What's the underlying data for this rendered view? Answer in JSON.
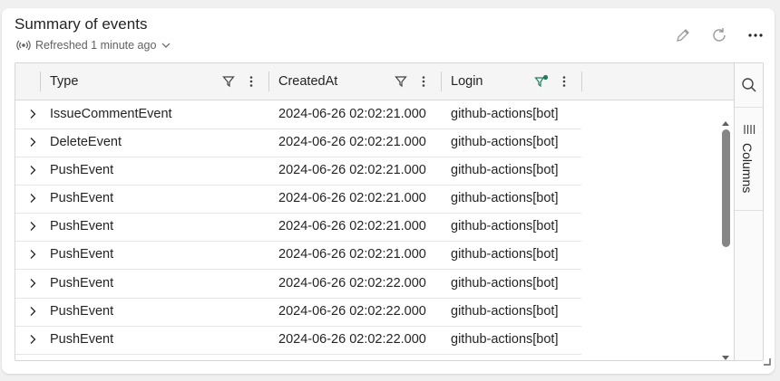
{
  "widget": {
    "title": "Summary of events",
    "refresh_status": "Refreshed 1 minute ago"
  },
  "toolbar": {
    "icons": [
      "edit-icon",
      "refresh-icon",
      "more-icon"
    ]
  },
  "grid": {
    "columns": [
      {
        "label": "Type",
        "filter_active": false
      },
      {
        "label": "CreatedAt",
        "filter_active": false
      },
      {
        "label": "Login",
        "filter_active": true
      }
    ],
    "rows": [
      {
        "type": "IssueCommentEvent",
        "created_at": "2024-06-26 02:02:21.000",
        "login": "github-actions[bot]"
      },
      {
        "type": "DeleteEvent",
        "created_at": "2024-06-26 02:02:21.000",
        "login": "github-actions[bot]"
      },
      {
        "type": "PushEvent",
        "created_at": "2024-06-26 02:02:21.000",
        "login": "github-actions[bot]"
      },
      {
        "type": "PushEvent",
        "created_at": "2024-06-26 02:02:21.000",
        "login": "github-actions[bot]"
      },
      {
        "type": "PushEvent",
        "created_at": "2024-06-26 02:02:21.000",
        "login": "github-actions[bot]"
      },
      {
        "type": "PushEvent",
        "created_at": "2024-06-26 02:02:21.000",
        "login": "github-actions[bot]"
      },
      {
        "type": "PushEvent",
        "created_at": "2024-06-26 02:02:22.000",
        "login": "github-actions[bot]"
      },
      {
        "type": "PushEvent",
        "created_at": "2024-06-26 02:02:22.000",
        "login": "github-actions[bot]"
      },
      {
        "type": "PushEvent",
        "created_at": "2024-06-26 02:02:22.000",
        "login": "github-actions[bot]"
      }
    ],
    "side_panel": {
      "columns_label": "Columns"
    }
  },
  "colors": {
    "filter_active": "#1a7f5a",
    "header_bg": "#f5f5f5",
    "scroll_thumb": "#868686"
  }
}
